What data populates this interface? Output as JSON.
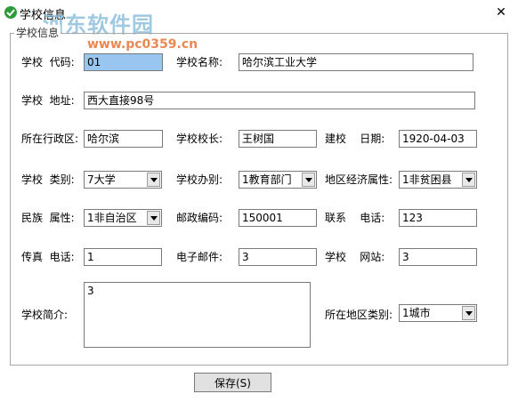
{
  "window": {
    "title": "学校信息",
    "close_label": "✕"
  },
  "watermark": {
    "text": "河东软件园",
    "url": "www.pc0359.cn"
  },
  "group": {
    "title": "学校信息"
  },
  "fields": {
    "code": {
      "label": "学校  代码:",
      "value": "01"
    },
    "name": {
      "label": "学校名称:",
      "value": "哈尔滨工业大学"
    },
    "address": {
      "label": "学校  地址:",
      "value": "西大直接98号"
    },
    "district": {
      "label": "所在行政区:",
      "value": "哈尔滨"
    },
    "president": {
      "label": "学校校长:",
      "value": "王树国"
    },
    "founded": {
      "label": "建校    日期:",
      "value": "1920-04-03"
    },
    "category": {
      "label": "学校  类别:",
      "value": "7大学"
    },
    "organizer": {
      "label": "学校办别:",
      "value": "1教育部门"
    },
    "economy": {
      "label": "地区经济属性:",
      "value": "1非贫困县"
    },
    "ethnic": {
      "label": "民族  属性:",
      "value": "1非自治区"
    },
    "postcode": {
      "label": "邮政编码:",
      "value": "150001"
    },
    "phone": {
      "label": "联系    电话:",
      "value": "123"
    },
    "fax": {
      "label": "传真  电话:",
      "value": "1"
    },
    "email": {
      "label": "电子邮件:",
      "value": "3"
    },
    "website": {
      "label": "学校    网站:",
      "value": "3"
    },
    "intro": {
      "label": "学校简介:",
      "value": "3"
    },
    "region_type": {
      "label": "所在地区类别:",
      "value": "1城市"
    }
  },
  "buttons": {
    "save": "保存(S)"
  },
  "colors": {
    "selected_field": "#99c6f0",
    "icon_green": "#2e9b3b"
  }
}
